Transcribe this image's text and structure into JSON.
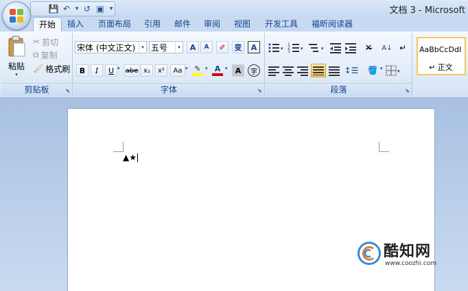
{
  "window": {
    "title": "文档 3 - Microsoft"
  },
  "qat": {
    "save": "💾",
    "undo": "↶",
    "undo_dd": "▾",
    "redo": "↺",
    "print": "▣",
    "customize": "▾"
  },
  "tabs": [
    {
      "label": "开始",
      "active": true
    },
    {
      "label": "插入"
    },
    {
      "label": "页面布局"
    },
    {
      "label": "引用"
    },
    {
      "label": "邮件"
    },
    {
      "label": "审阅"
    },
    {
      "label": "视图"
    },
    {
      "label": "开发工具"
    },
    {
      "label": "福昕阅读器"
    }
  ],
  "clipboard": {
    "paste": "粘贴",
    "cut": "剪切",
    "copy": "复制",
    "format_painter": "格式刷",
    "group": "剪贴板"
  },
  "font": {
    "name": "宋体 (中文正文)",
    "size": "五号",
    "grow": "A",
    "shrink": "A",
    "clear": "A",
    "phonetic": "变",
    "border": "A",
    "bold": "B",
    "italic": "I",
    "underline": "U",
    "strike": "abe",
    "subscript": "x₂",
    "superscript": "x²",
    "case": "Aa",
    "highlight": "✎",
    "color": "A",
    "shading": "A",
    "enclose": "字",
    "group": "字体"
  },
  "paragraph": {
    "group": "段落"
  },
  "styles": {
    "sample": "AaBbCcDdI",
    "name": "↵ 正文"
  },
  "document": {
    "text": "▲★"
  },
  "watermark": {
    "title": "酷知网",
    "url": "www.coozhi.com"
  },
  "colors": {
    "highlight": "#ffff00",
    "font_color": "#d00000"
  }
}
